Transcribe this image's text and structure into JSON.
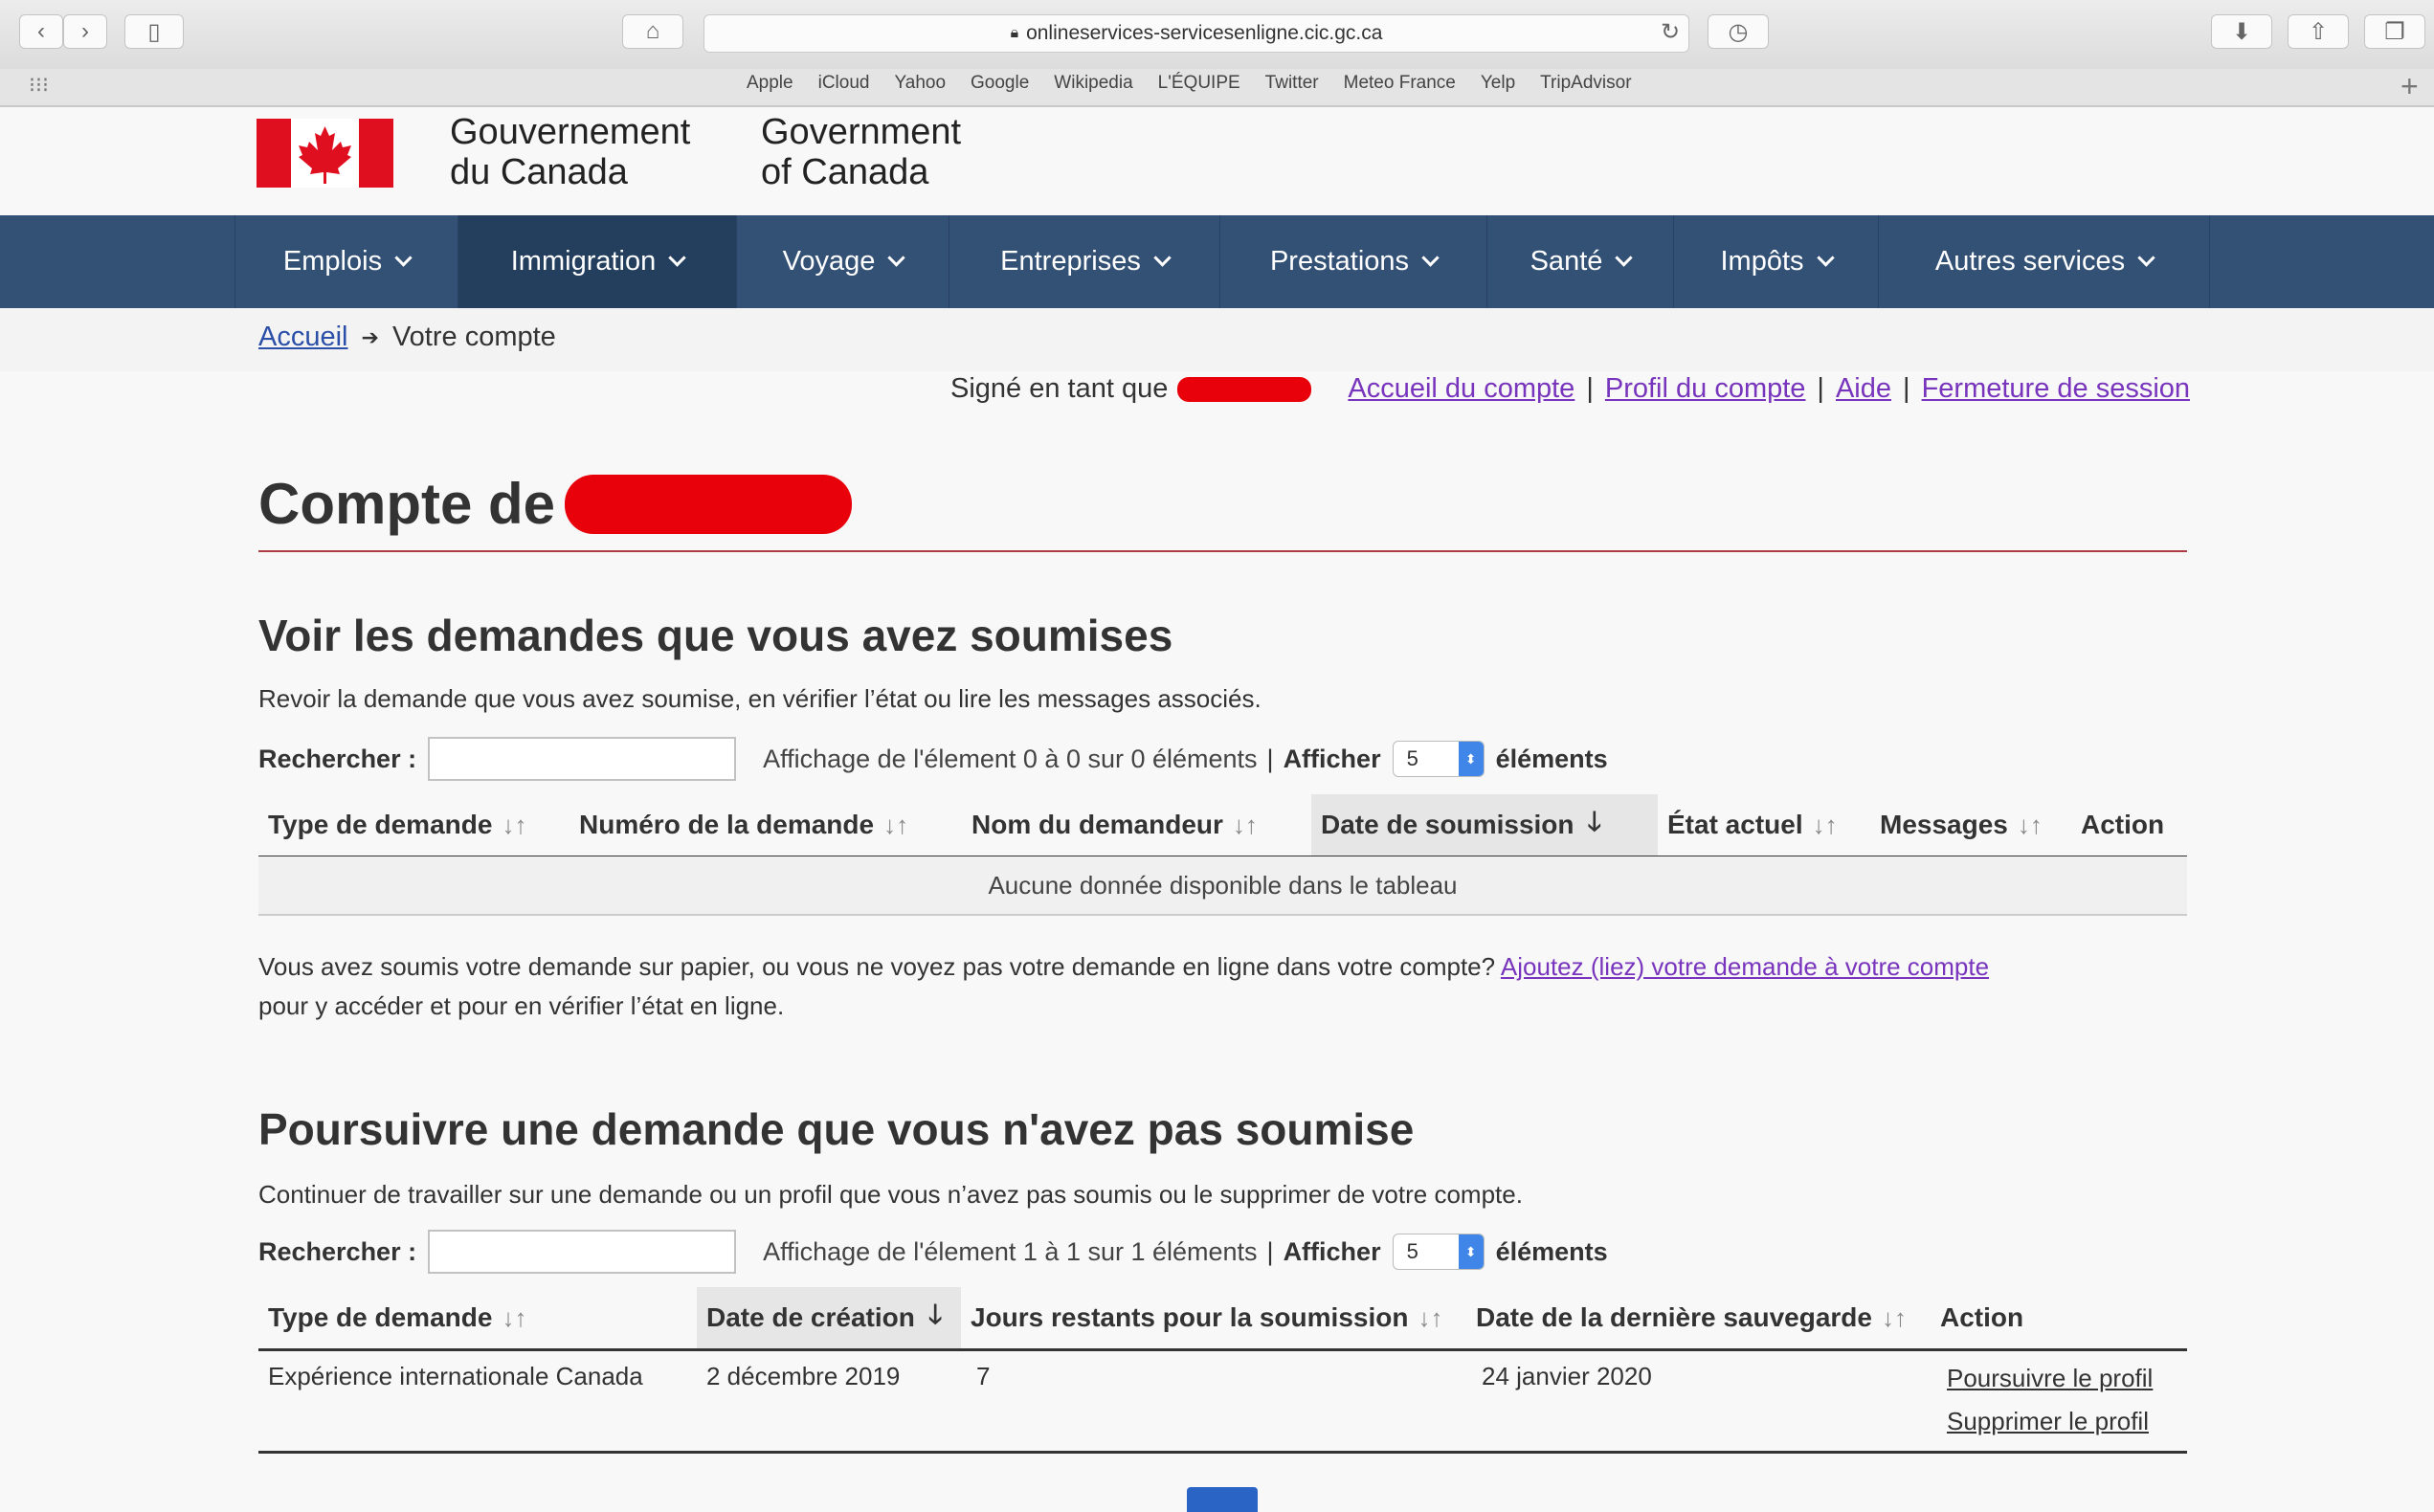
{
  "browser": {
    "url": "onlineservices-servicesenligne.cic.gc.ca",
    "bookmarks": [
      "Apple",
      "iCloud",
      "Yahoo",
      "Google",
      "Wikipedia",
      "L'ÉQUIPE",
      "Twitter",
      "Meteo France",
      "Yelp",
      "TripAdvisor"
    ]
  },
  "header": {
    "gov_fr_line1": "Gouvernement",
    "gov_fr_line2": "du Canada",
    "gov_en_line1": "Government",
    "gov_en_line2": "of Canada"
  },
  "nav": {
    "items": [
      "Emplois",
      "Immigration",
      "Voyage",
      "Entreprises",
      "Prestations",
      "Santé",
      "Impôts",
      "Autres services"
    ],
    "active": "Immigration"
  },
  "breadcrumb": {
    "home": "Accueil",
    "arrow": "➔",
    "current": "Votre compte"
  },
  "account_links": {
    "signed_in_as": "Signé en tant que",
    "links": [
      "Accueil du compte",
      "Profil du compte",
      "Aide",
      "Fermeture de session"
    ]
  },
  "page_title": "Compte de",
  "submitted": {
    "heading": "Voir les demandes que vous avez soumises",
    "description": "Revoir la demande que vous avez soumise, en vérifier l’état ou lire les messages associés.",
    "search_label": "Rechercher :",
    "info": "Affichage de l'élement 0 à 0 sur 0 éléments",
    "show_label": "Afficher",
    "show_value": "5",
    "show_suffix": "éléments",
    "columns": [
      "Type de demande",
      "Numéro de la demande",
      "Nom du demandeur",
      "Date de soumission",
      "État actuel",
      "Messages",
      "Action"
    ],
    "empty_message": "Aucune donnée disponible dans le tableau",
    "paper_note_1": "Vous avez soumis votre demande sur papier, ou vous ne voyez pas votre demande en ligne dans votre compte?",
    "paper_link": "Ajoutez (liez) votre demande à votre compte",
    "paper_note_2": "pour y accéder et pour en vérifier l’état en ligne."
  },
  "unsubmitted": {
    "heading": "Poursuivre une demande que vous n'avez pas soumise",
    "description": "Continuer de travailler sur une demande ou un profil que vous n’avez pas soumis ou le supprimer de votre compte.",
    "search_label": "Rechercher :",
    "info": "Affichage de l'élement 1 à 1 sur 1 éléments",
    "show_label": "Afficher",
    "show_value": "5",
    "show_suffix": "éléments",
    "columns": [
      "Type de demande",
      "Date de création",
      "Jours restants pour la soumission",
      "Date de la dernière sauvegarde",
      "Action"
    ],
    "rows": [
      {
        "type": "Expérience internationale Canada",
        "created": "2 décembre 2019",
        "days_left": "7",
        "last_saved": "24 janvier 2020",
        "action_continue": "Poursuivre le profil",
        "action_delete": "Supprimer le profil"
      }
    ]
  },
  "colors": {
    "nav": "#335075",
    "nav_active": "#243f5e",
    "title_rule": "#af3c43",
    "link": "#2b4ea8",
    "visited": "#7834bc",
    "redaction": "#e8000b"
  }
}
